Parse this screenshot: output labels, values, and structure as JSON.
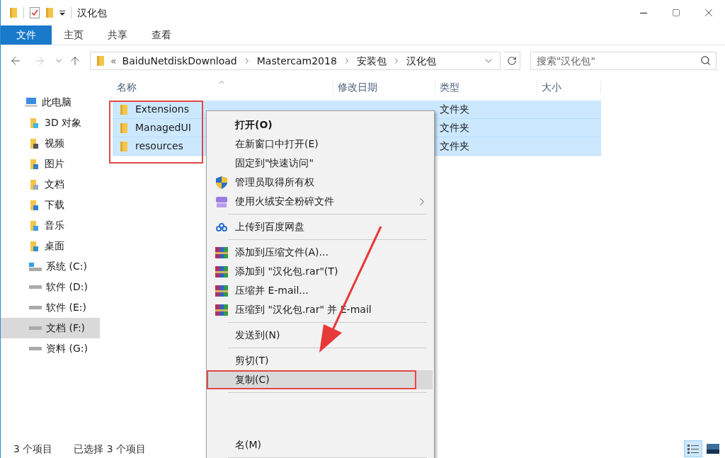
{
  "window": {
    "title": "汉化包"
  },
  "ribbon_tabs": [
    {
      "label": "文件",
      "selected": true
    },
    {
      "label": "主页",
      "selected": false
    },
    {
      "label": "共享",
      "selected": false
    },
    {
      "label": "查看",
      "selected": false
    }
  ],
  "address": {
    "overflow": "«",
    "path": [
      "BaiduNetdiskDownload",
      "Mastercam2018",
      "安装包",
      "汉化包"
    ]
  },
  "search": {
    "placeholder": "搜索\"汉化包\""
  },
  "sidebar": {
    "items": [
      {
        "label": "此电脑",
        "kind": "pc",
        "selected": false
      },
      {
        "label": "3D 对象",
        "kind": "objects",
        "selected": false
      },
      {
        "label": "视频",
        "kind": "video",
        "selected": false
      },
      {
        "label": "图片",
        "kind": "pictures",
        "selected": false
      },
      {
        "label": "文档",
        "kind": "documents",
        "selected": false
      },
      {
        "label": "下载",
        "kind": "downloads",
        "selected": false
      },
      {
        "label": "音乐",
        "kind": "music",
        "selected": false
      },
      {
        "label": "桌面",
        "kind": "desktop",
        "selected": false
      },
      {
        "label": "系统 (C:)",
        "kind": "system-drive",
        "selected": false
      },
      {
        "label": "软件 (D:)",
        "kind": "drive",
        "selected": false
      },
      {
        "label": "软件 (E:)",
        "kind": "drive",
        "selected": false
      },
      {
        "label": "文档 (F:)",
        "kind": "drive",
        "selected": true
      },
      {
        "label": "资料 (G:)",
        "kind": "drive",
        "selected": false
      }
    ]
  },
  "table": {
    "columns": [
      "名称",
      "修改日期",
      "类型",
      "大小"
    ],
    "rows": [
      {
        "name": "Extensions",
        "type": "文件夹",
        "selected": true
      },
      {
        "name": "ManagedUI",
        "type": "文件夹",
        "selected": true
      },
      {
        "name": "resources",
        "type": "文件夹",
        "selected": true
      }
    ]
  },
  "context_menu": {
    "items": [
      {
        "kind": "plain",
        "label": "打开(O)",
        "bold": true,
        "submenu": false,
        "selected": false
      },
      {
        "kind": "plain",
        "label": "在新窗口中打开(E)",
        "bold": false,
        "submenu": false,
        "selected": false
      },
      {
        "kind": "plain",
        "label": "固定到\"快速访问\"",
        "bold": false,
        "submenu": false,
        "selected": false
      },
      {
        "kind": "shield",
        "label": "管理员取得所有权",
        "bold": false,
        "submenu": false,
        "selected": false
      },
      {
        "kind": "shredder",
        "label": "使用火绒安全粉碎文件",
        "bold": false,
        "submenu": true,
        "selected": false
      },
      {
        "kind": "separator"
      },
      {
        "kind": "cloud",
        "label": "上传到百度网盘",
        "bold": false,
        "submenu": false,
        "selected": false
      },
      {
        "kind": "separator"
      },
      {
        "kind": "archive",
        "label": "添加到压缩文件(A)...",
        "bold": false,
        "submenu": false,
        "selected": false
      },
      {
        "kind": "archive",
        "label": "添加到 \"汉化包.rar\"(T)",
        "bold": false,
        "submenu": false,
        "selected": false
      },
      {
        "kind": "archive",
        "label": "压缩并 E-mail...",
        "bold": false,
        "submenu": false,
        "selected": false
      },
      {
        "kind": "archive",
        "label": "压缩到 \"汉化包.rar\" 并 E-mail",
        "bold": false,
        "submenu": false,
        "selected": false
      },
      {
        "kind": "separator"
      },
      {
        "kind": "plain",
        "label": "发送到(N)",
        "bold": false,
        "submenu": false,
        "selected": false
      },
      {
        "kind": "separator"
      },
      {
        "kind": "plain",
        "label": "剪切(T)",
        "bold": false,
        "submenu": false,
        "selected": false
      },
      {
        "kind": "plain",
        "label": "复制(C)",
        "bold": false,
        "submenu": false,
        "selected": true
      },
      {
        "kind": "separator"
      },
      {
        "kind": "obscured"
      },
      {
        "kind": "obscured"
      },
      {
        "kind": "plain",
        "label": "名(M)",
        "bold": false,
        "submenu": false,
        "selected": false
      },
      {
        "kind": "separator"
      }
    ]
  },
  "status_bar": {
    "item_count": "3 个项目",
    "selection": "已选择 3 个项目"
  },
  "view_buttons": [
    {
      "kind": "details",
      "selected": true
    },
    {
      "kind": "tiles",
      "selected": false
    }
  ]
}
